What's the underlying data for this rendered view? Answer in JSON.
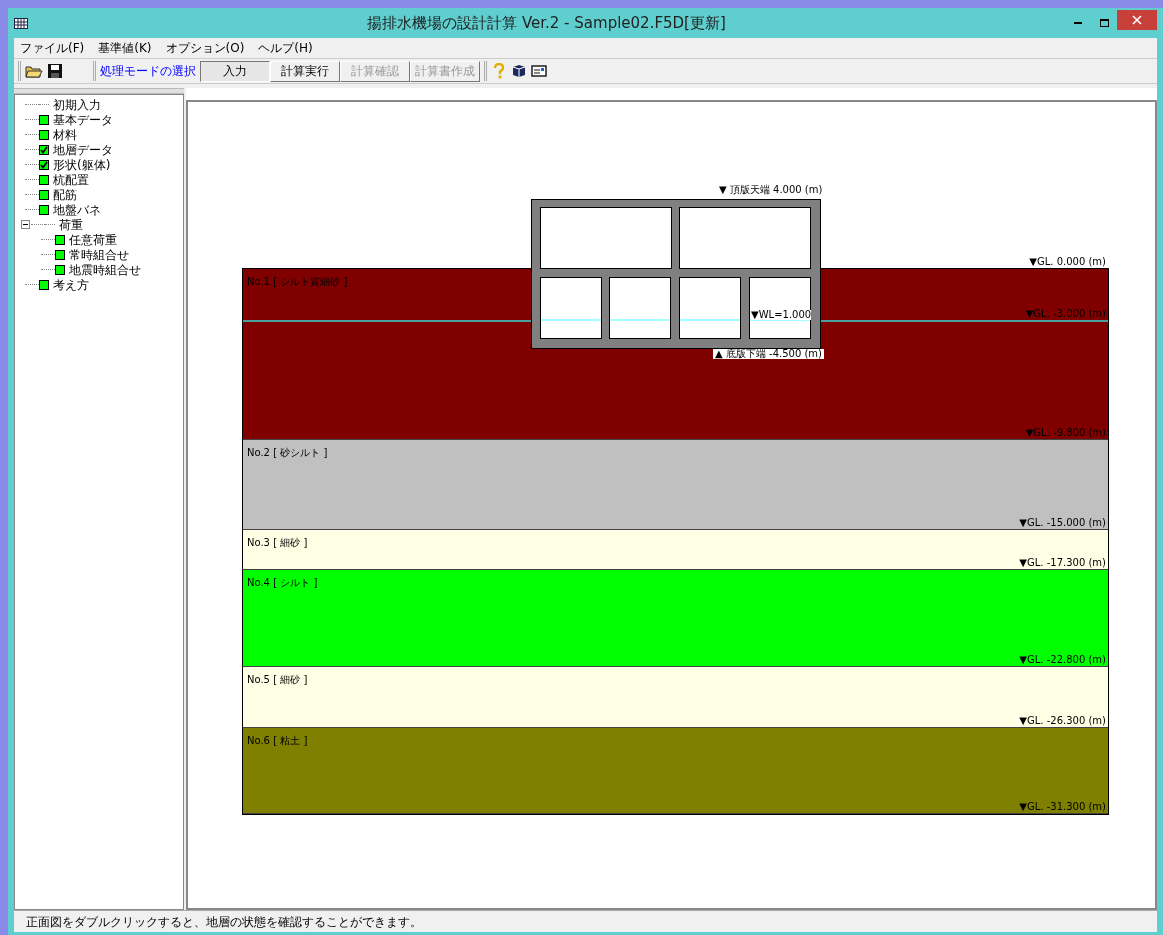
{
  "window": {
    "title": "揚排水機場の設計計算 Ver.2 - Sample02.F5D[更新]"
  },
  "menu": [
    "ファイル(F)",
    "基準値(K)",
    "オプション(O)",
    "ヘルプ(H)"
  ],
  "toolbar": {
    "mode_label": "処理モードの選択",
    "buttons": [
      {
        "label": "入力",
        "selected": true,
        "disabled": false
      },
      {
        "label": "計算実行",
        "selected": false,
        "disabled": false
      },
      {
        "label": "計算確認",
        "selected": false,
        "disabled": true
      },
      {
        "label": "計算書作成",
        "selected": false,
        "disabled": true
      }
    ]
  },
  "tree": [
    {
      "label": "初期入力",
      "kind": "plain"
    },
    {
      "label": "基本データ",
      "kind": "box",
      "checked": false
    },
    {
      "label": "材料",
      "kind": "box",
      "checked": false
    },
    {
      "label": "地層データ",
      "kind": "box",
      "checked": true
    },
    {
      "label": "形状(躯体)",
      "kind": "box",
      "checked": true
    },
    {
      "label": "杭配置",
      "kind": "box",
      "checked": false
    },
    {
      "label": "配筋",
      "kind": "box",
      "checked": false
    },
    {
      "label": "地盤バネ",
      "kind": "box",
      "checked": false
    },
    {
      "label": "荷重",
      "kind": "group",
      "expanded": true,
      "children": [
        {
          "label": "任意荷重",
          "kind": "box",
          "checked": false
        },
        {
          "label": "常時組合せ",
          "kind": "box",
          "checked": false
        },
        {
          "label": "地震時組合せ",
          "kind": "box",
          "checked": false
        }
      ]
    },
    {
      "label": "考え方",
      "kind": "box",
      "checked": false
    }
  ],
  "drawing": {
    "top_label": "▼ 頂版天端 4.000 (m)",
    "bottom_label": "▲ 底版下端 -4.500 (m)",
    "wl_label": "▼WL=1.000",
    "gl_label": "▼GL. 0.000 (m)",
    "water_gl_label": "▼GL. -3.000 (m)",
    "layers": [
      {
        "label": "No.1 [ シルト質細砂 ]",
        "depth": "▼GL. -9.800 (m)",
        "color": "#800000"
      },
      {
        "label": "No.2 [ 砂シルト ]",
        "depth": "▼GL. -15.000 (m)",
        "color": "#c0c0c0"
      },
      {
        "label": "No.3 [ 細砂 ]",
        "depth": "▼GL. -17.300 (m)",
        "color": "#ffffe6"
      },
      {
        "label": "No.4 [ シルト ]",
        "depth": "▼GL. -22.800 (m)",
        "color": "#00ff00"
      },
      {
        "label": "No.5 [ 細砂 ]",
        "depth": "▼GL. -26.300 (m)",
        "color": "#ffffe6"
      },
      {
        "label": "No.6 [ 粘土 ]",
        "depth": "▼GL. -31.300 (m)",
        "color": "#808000"
      }
    ]
  },
  "status_bar": "正面図をダブルクリックすると、地層の状態を確認することができます。"
}
